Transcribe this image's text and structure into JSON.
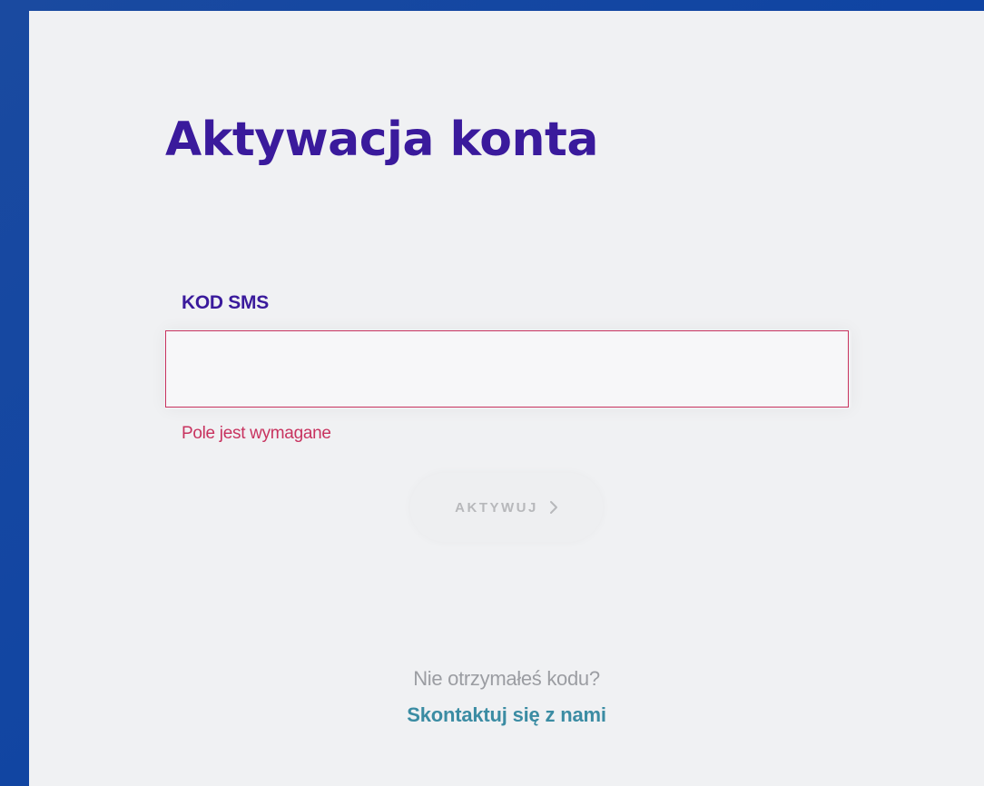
{
  "page": {
    "title": "Aktywacja konta"
  },
  "form": {
    "sms_label": "KOD SMS",
    "sms_value": "",
    "sms_placeholder": "",
    "error_message": "Pole jest wymagane",
    "submit_label": "AKTYWUJ",
    "submit_icon": "chevron-right-icon"
  },
  "footer": {
    "question": "Nie otrzymałeś kodu?",
    "contact_link": "Skontaktuj się z nami"
  },
  "colors": {
    "background": "#0f44a3",
    "panel": "#f0f1f3",
    "title": "#3a1a9c",
    "error": "#c8335f",
    "link": "#3b8ca3",
    "disabled_text": "#b7b8bb"
  }
}
